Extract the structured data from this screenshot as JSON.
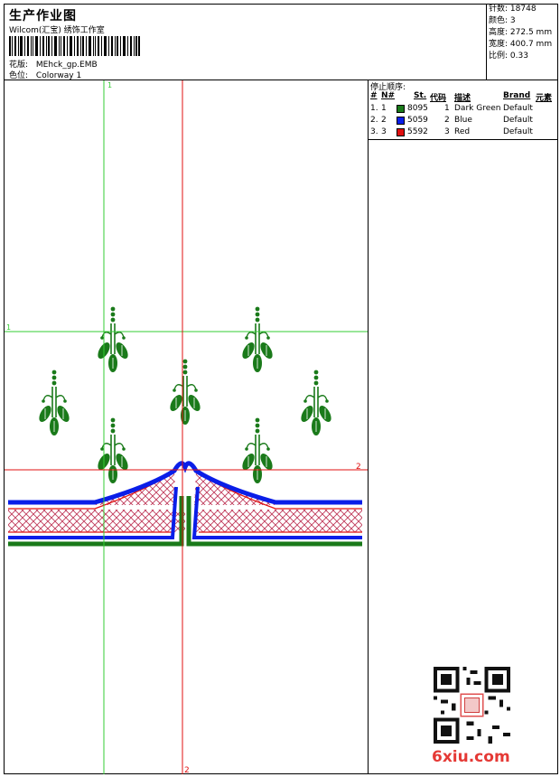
{
  "header": {
    "title": "生产作业图",
    "subtitle": "Wilcom(汇宝) 绣饰工作室",
    "design_label": "花版:",
    "design_value": "MEhck_gp.EMB",
    "colorway_label": "色位:",
    "colorway_value": "Colorway 1"
  },
  "stats": [
    {
      "label": "针数:",
      "value": "18748"
    },
    {
      "label": "颜色:",
      "value": "3"
    },
    {
      "label": "高度:",
      "value": "272.5 mm"
    },
    {
      "label": "宽度:",
      "value": "400.7 mm"
    },
    {
      "label": "比例:",
      "value": "0.33"
    }
  ],
  "stop_sequence": {
    "title": "停止顺序:",
    "columns": [
      "#",
      "N#",
      "St.",
      "代码",
      "描述",
      "Brand",
      "元素"
    ],
    "rows": [
      {
        "idx": "1.",
        "n": "1",
        "color": "#1a7a1a",
        "st": "8095",
        "code": "1",
        "desc": "Dark Green",
        "brand": "Default"
      },
      {
        "idx": "2.",
        "n": "2",
        "color": "#0a1ee8",
        "st": "5059",
        "code": "2",
        "desc": "Blue",
        "brand": "Default"
      },
      {
        "idx": "3.",
        "n": "3",
        "color": "#e01010",
        "st": "5592",
        "code": "3",
        "desc": "Red",
        "brand": "Default"
      }
    ]
  },
  "guides": {
    "green_v": "1",
    "green_h": "1",
    "red_h": "2",
    "red_v": "2"
  },
  "watermark": "6xiu.com",
  "colors": {
    "green": "#1a7a1a",
    "blue": "#0a1ee8",
    "red": "#e01010",
    "guide_green": "#33cc33",
    "guide_red": "#e01010"
  }
}
